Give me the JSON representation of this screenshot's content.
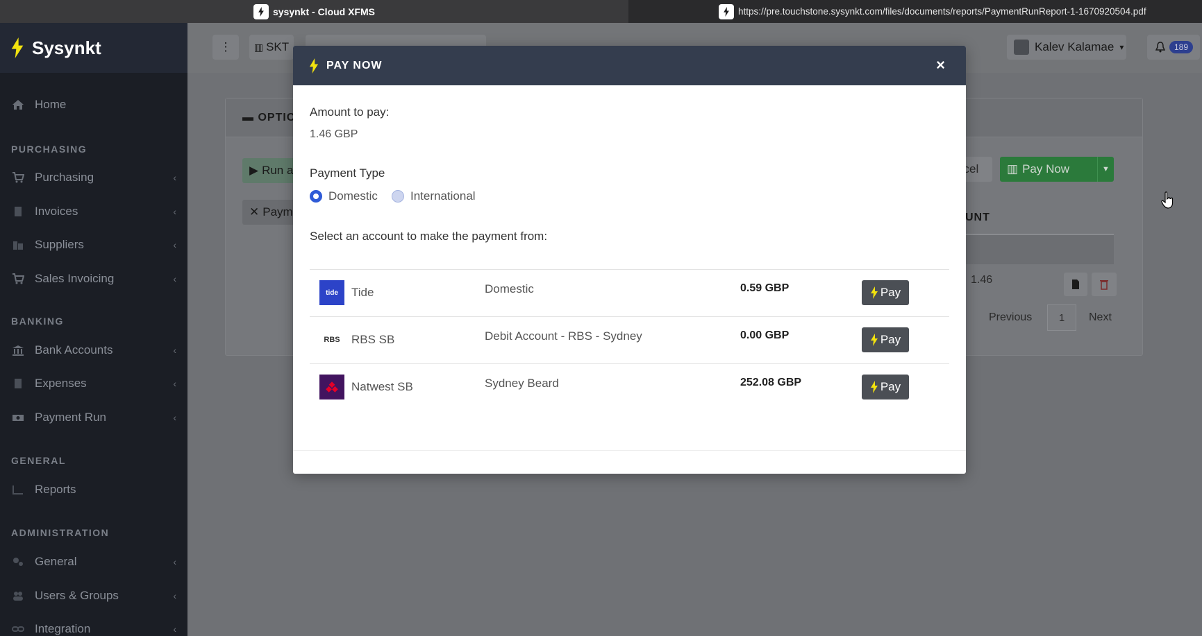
{
  "browser": {
    "tab1_title": "sysynkt - Cloud XFMS",
    "tab2_url": "https://pre.touchstone.sysynkt.com/files/documents/reports/PaymentRunReport-1-1670920504.pdf"
  },
  "sidebar": {
    "brand": "Sysynkt",
    "home": "Home",
    "sections": [
      {
        "title": "PURCHASING",
        "items": [
          "Purchasing",
          "Invoices",
          "Suppliers",
          "Sales Invoicing"
        ]
      },
      {
        "title": "BANKING",
        "items": [
          "Bank Accounts",
          "Expenses",
          "Payment Run"
        ]
      },
      {
        "title": "GENERAL",
        "items": [
          "Reports"
        ]
      },
      {
        "title": "ADMINISTRATION",
        "items": [
          "General",
          "Users & Groups",
          "Integration"
        ]
      }
    ]
  },
  "topbar": {
    "org": "SKT",
    "user": "Kalev Kalamae",
    "notifications": "189"
  },
  "background": {
    "card_header": "OPTIC",
    "run_label": "Run a",
    "paym_label": "Paym",
    "cancel_label": "Cancel",
    "paynow_label": "Pay Now",
    "col_header": "UNT",
    "amount": "1.46",
    "prev": "Previous",
    "page": "1",
    "next": "Next"
  },
  "modal": {
    "title": "PAY NOW",
    "close": "×",
    "amount_label": "Amount to pay:",
    "amount_value": "1.46 GBP",
    "payment_type_label": "Payment Type",
    "payment_types": [
      {
        "label": "Domestic",
        "selected": true
      },
      {
        "label": "International",
        "selected": false
      }
    ],
    "select_account_label": "Select an account to make the payment from:",
    "pay_label": "Pay",
    "accounts": [
      {
        "name": "Tide",
        "logo": "tide",
        "type": "Domestic",
        "balance": "0.59 GBP"
      },
      {
        "name": "RBS SB",
        "logo": "RBS",
        "type": "Debit Account - RBS - Sydney",
        "balance": "0.00 GBP"
      },
      {
        "name": "Natwest SB",
        "logo": "natwest",
        "type": "Sydney Beard",
        "balance": "252.08 GBP"
      }
    ]
  },
  "colors": {
    "sidebar_bg": "#1b1e25",
    "modal_header": "#343d4e",
    "accent_green": "#2b7a3b",
    "radio_blue": "#2f5bd7",
    "pay_button": "#4b4f55"
  }
}
